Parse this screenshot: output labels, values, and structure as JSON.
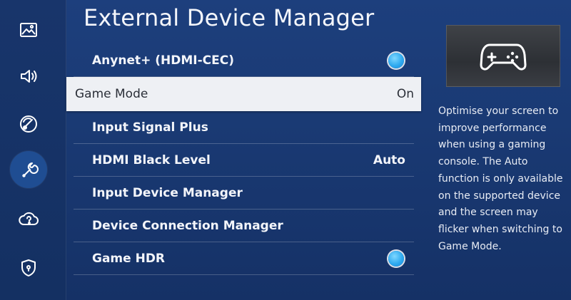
{
  "sidebar": {
    "icons": [
      {
        "name": "picture-icon"
      },
      {
        "name": "sound-icon"
      },
      {
        "name": "broadcasting-icon"
      },
      {
        "name": "general-wrench-icon"
      },
      {
        "name": "support-cloud-icon"
      },
      {
        "name": "privacy-shield-icon"
      }
    ],
    "active_index": 3
  },
  "main": {
    "title": "External Device Manager",
    "items": [
      {
        "label": "Anynet+ (HDMI-CEC)",
        "value": "",
        "toggle": true
      },
      {
        "label": "Game Mode",
        "value": "On",
        "toggle": false,
        "selected": true
      },
      {
        "label": "Input Signal Plus",
        "value": "",
        "toggle": false
      },
      {
        "label": "HDMI Black Level",
        "value": "Auto",
        "toggle": false
      },
      {
        "label": "Input Device Manager",
        "value": "",
        "toggle": false
      },
      {
        "label": "Device Connection Manager",
        "value": "",
        "toggle": false
      },
      {
        "label": "Game HDR",
        "value": "",
        "toggle": true
      }
    ]
  },
  "info": {
    "preview_icon": "gamepad-icon",
    "description": "Optimise your screen to improve performance when using a gaming console. The Auto function is only available on the supported device and the screen may flicker when switching to Game Mode."
  },
  "colors": {
    "background": "#1a3a74",
    "selected_row": "#eef0f4",
    "toggle_on": "#2eaaf0"
  }
}
